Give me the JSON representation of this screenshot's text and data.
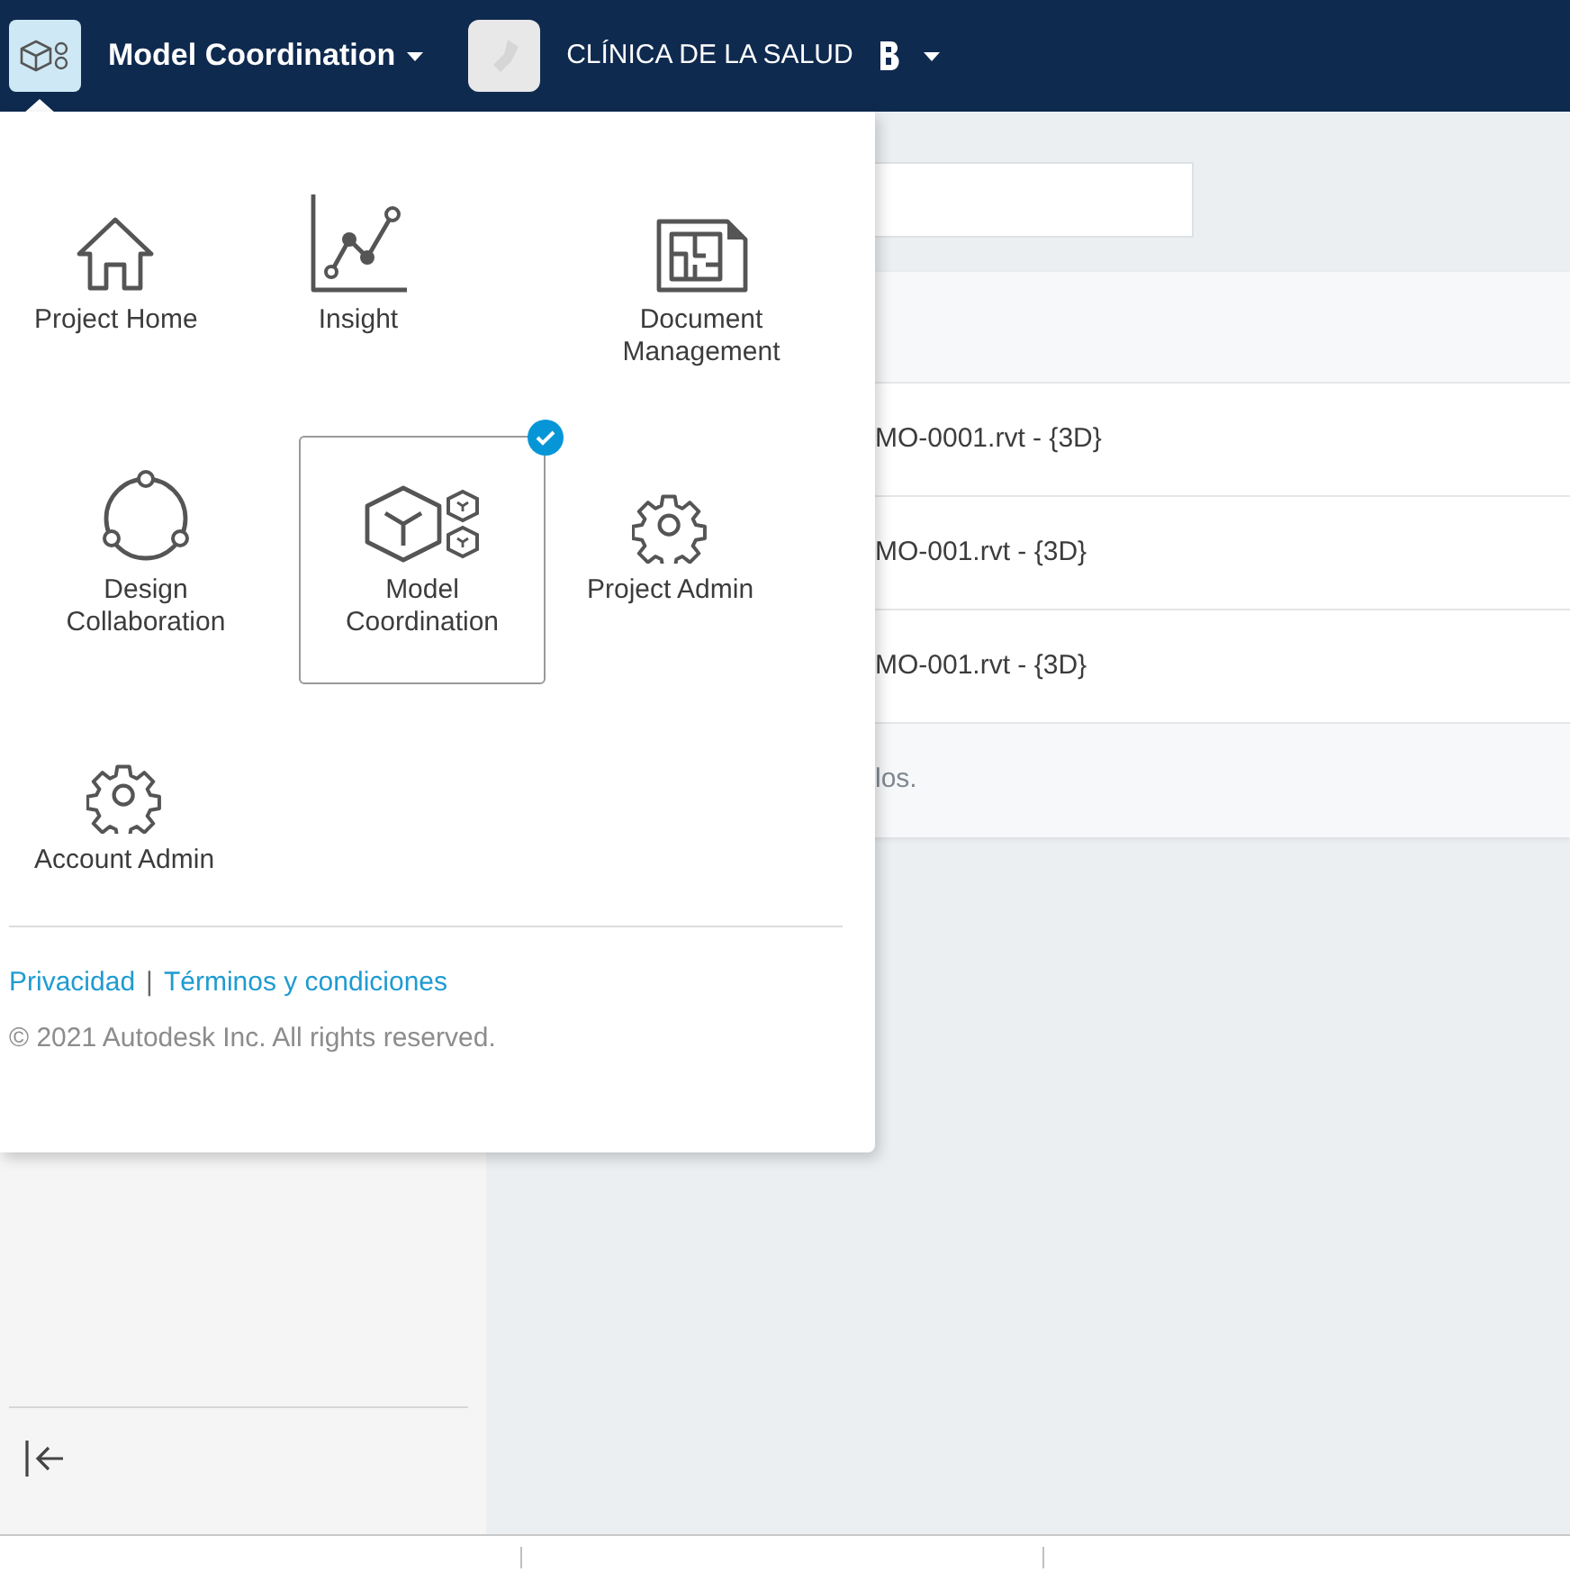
{
  "navbar": {
    "app_name": "Model Coordination",
    "project_name": "CLÍNICA DE LA SALUD"
  },
  "app_menu": {
    "items": [
      {
        "label": "Project Home",
        "kind": "home",
        "selected": false
      },
      {
        "label": "Insight",
        "kind": "insight",
        "selected": false
      },
      {
        "label": "Document Management",
        "kind": "document",
        "selected": false
      },
      {
        "label": "Design Collaboration",
        "kind": "collaboration",
        "selected": false
      },
      {
        "label": "Model Coordination",
        "kind": "model",
        "selected": true
      },
      {
        "label": "Project Admin",
        "kind": "gear",
        "selected": false
      },
      {
        "label": "Account Admin",
        "kind": "gear",
        "selected": false
      }
    ],
    "links": [
      "Privacidad",
      "Términos y condiciones"
    ],
    "separator": "|",
    "copyright": "© 2021 Autodesk Inc. All rights reserved."
  },
  "table": {
    "rows": [
      "MO-0001.rvt - {3D}",
      "MO-001.rvt - {3D}",
      "MO-001.rvt - {3D}"
    ],
    "footer": "los."
  }
}
